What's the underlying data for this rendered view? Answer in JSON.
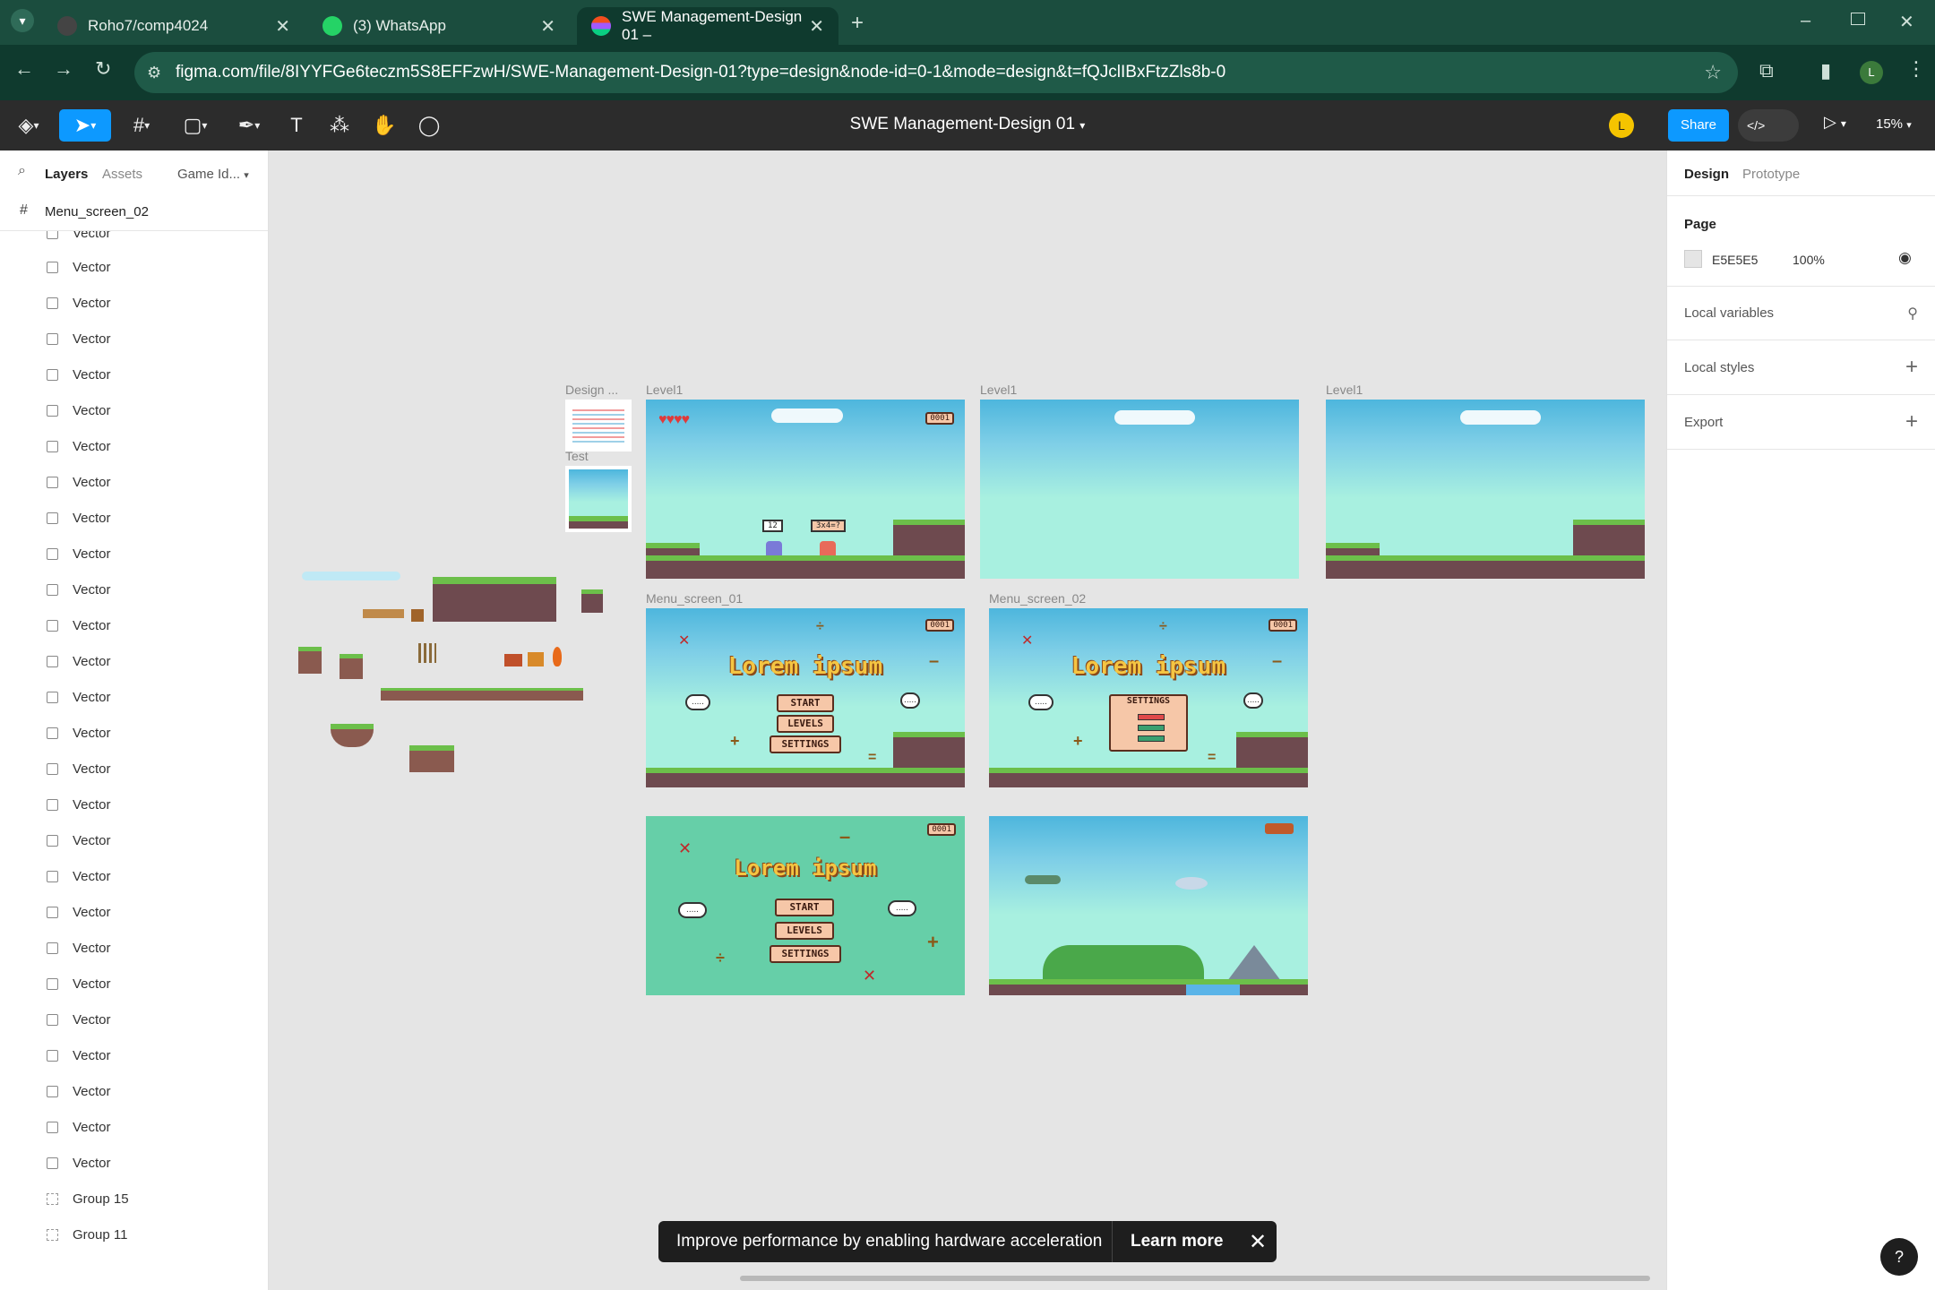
{
  "browser": {
    "tabs": [
      {
        "title": "Roho7/comp4024",
        "icon": "github-icon"
      },
      {
        "title": "(3) WhatsApp",
        "icon": "whatsapp-icon"
      },
      {
        "title": "SWE Management-Design 01 –",
        "icon": "figma-icon"
      }
    ],
    "url": "figma.com/file/8IYYFGe6teczm5S8EFFzwH/SWE-Management-Design-01?type=design&node-id=0-1&mode=design&t=fQJclIBxFtzZls8b-0",
    "profile_initial": "L"
  },
  "toolbar": {
    "document_title": "SWE Management-Design 01",
    "user_initial": "L",
    "share_label": "Share",
    "zoom": "15%"
  },
  "left_panel": {
    "tabs": [
      "Layers",
      "Assets"
    ],
    "page_selector": "Game Id...",
    "selected_frame": "Menu_screen_02",
    "layers": [
      "Vector",
      "Vector",
      "Vector",
      "Vector",
      "Vector",
      "Vector",
      "Vector",
      "Vector",
      "Vector",
      "Vector",
      "Vector",
      "Vector",
      "Vector",
      "Vector",
      "Vector",
      "Vector",
      "Vector",
      "Vector",
      "Vector",
      "Vector",
      "Vector",
      "Vector",
      "Vector",
      "Vector",
      "Vector",
      "Vector",
      "Group 15",
      "Group 11"
    ],
    "top_partial_layer": "Vector"
  },
  "right_panel": {
    "tabs": [
      "Design",
      "Prototype"
    ],
    "page_heading": "Page",
    "page_color": "E5E5E5",
    "page_opacity": "100%",
    "rows": [
      "Local variables",
      "Local styles",
      "Export"
    ]
  },
  "canvas": {
    "frame_labels": {
      "design": "Design ...",
      "test": "Test",
      "level1_a": "Level1",
      "level1_b": "Level1",
      "level1_c": "Level1",
      "menu1": "Menu_screen_01",
      "menu2": "Menu_screen_02"
    },
    "game_text": {
      "lorem": "Lorem ipsum",
      "start": "START",
      "levels": "LEVELS",
      "settings": "SETTINGS",
      "coins": "0001",
      "bubble": ".....",
      "score_box": "12",
      "question": "3x4=?"
    }
  },
  "toast": {
    "message": "Improve performance by enabling hardware acceleration",
    "action": "Learn more"
  },
  "help_label": "?"
}
